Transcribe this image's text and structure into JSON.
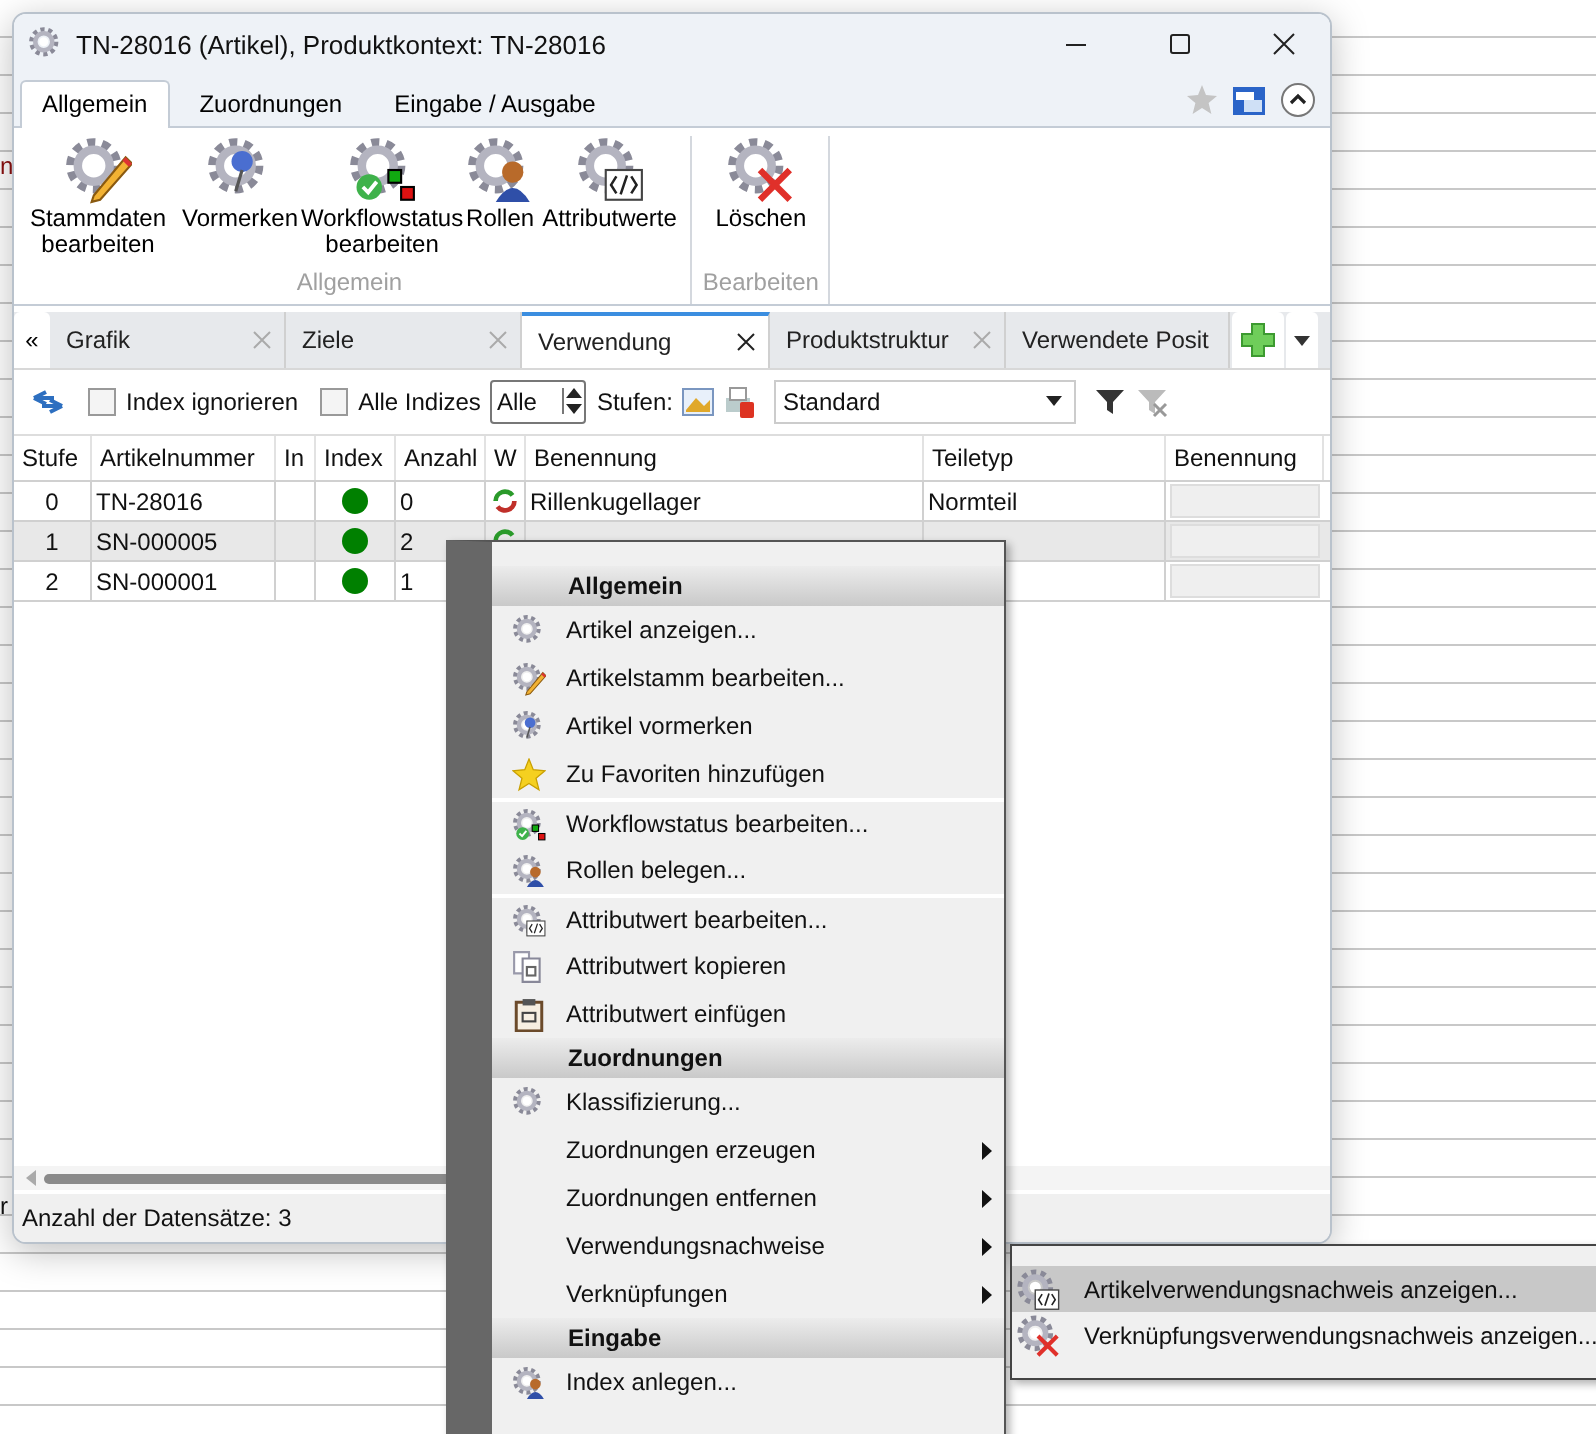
{
  "background_fragments": [
    "n",
    "r"
  ],
  "window": {
    "title": "TN-28016 (Artikel), Produktkontext: TN-28016"
  },
  "ribbon": {
    "tabs": [
      {
        "label": "Allgemein",
        "selected": true
      },
      {
        "label": "Zuordnungen",
        "selected": false
      },
      {
        "label": "Eingabe / Ausgabe",
        "selected": false
      }
    ],
    "groups": [
      {
        "label": "Allgemein",
        "buttons": [
          "Stammdaten bearbeiten",
          "Vormerken",
          "Workflowstatus bearbeiten",
          "Rollen",
          "Attributwerte"
        ]
      },
      {
        "label": "Bearbeiten",
        "buttons": [
          "Löschen"
        ]
      }
    ]
  },
  "doc_tabs": {
    "scroll_left": "«",
    "tabs": [
      {
        "label": "Grafik",
        "selected": false
      },
      {
        "label": "Ziele",
        "selected": false
      },
      {
        "label": "Verwendung",
        "selected": true
      },
      {
        "label": "Produktstruktur",
        "selected": false
      },
      {
        "label": "Verwendete Posit",
        "selected": false
      }
    ]
  },
  "toolbar": {
    "checkboxes": [
      {
        "label": "Index ignorieren",
        "checked": false
      },
      {
        "label": "Alle Indizes",
        "checked": false
      }
    ],
    "spin_value": "Alle",
    "stufen_label": "Stufen:",
    "view_dropdown": "Standard"
  },
  "table": {
    "columns": [
      "Stufe",
      "Artikelnummer",
      "In",
      "Index",
      "Anzahl",
      "W",
      "Benennung",
      "Teiletyp",
      "Benennung"
    ],
    "rows": [
      {
        "stufe": "0",
        "artikelnummer": "TN-28016",
        "color": "#008000",
        "anzahl": "0",
        "w_icon": true,
        "benennung": "Rillenkugellager",
        "teiletyp": "Normteil",
        "selected": false
      },
      {
        "stufe": "1",
        "artikelnummer": "SN-000005",
        "color": "#008000",
        "anzahl": "2",
        "w_icon": true,
        "selected": true
      },
      {
        "stufe": "2",
        "artikelnummer": "SN-000001",
        "color": "#008000",
        "anzahl": "1",
        "selected": false
      }
    ]
  },
  "status_bar": "Anzahl der Datensätze: 3",
  "context_menu": [
    {
      "kind": "header",
      "label": "Allgemein"
    },
    {
      "kind": "command",
      "label": "Artikel anzeigen...",
      "divider_above": false
    },
    {
      "kind": "command",
      "label": "Artikelstamm bearbeiten...",
      "divider_above": false
    },
    {
      "kind": "command",
      "label": "Artikel vormerken",
      "divider_above": false
    },
    {
      "kind": "command",
      "label": "Zu Favoriten hinzufügen",
      "divider_above": false
    },
    {
      "kind": "command",
      "label": "Workflowstatus bearbeiten...",
      "divider_above": true
    },
    {
      "kind": "command",
      "label": "Rollen belegen...",
      "divider_above": false
    },
    {
      "kind": "command",
      "label": "Attributwert bearbeiten...",
      "divider_above": true
    },
    {
      "kind": "command",
      "label": "Attributwert kopieren",
      "divider_above": false
    },
    {
      "kind": "command",
      "label": "Attributwert einfügen",
      "divider_above": false
    },
    {
      "kind": "header",
      "label": "Zuordnungen"
    },
    {
      "kind": "command",
      "label": "Klassifizierung...",
      "divider_above": false
    },
    {
      "kind": "submenu",
      "label": "Zuordnungen erzeugen",
      "divider_above": false
    },
    {
      "kind": "submenu",
      "label": "Zuordnungen entfernen",
      "divider_above": false
    },
    {
      "kind": "submenu",
      "label": "Verwendungsnachweise",
      "divider_above": false
    },
    {
      "kind": "submenu",
      "label": "Verknüpfungen",
      "divider_above": false
    },
    {
      "kind": "header",
      "label": "Eingabe"
    },
    {
      "kind": "command",
      "label": "Index anlegen...",
      "divider_above": false
    }
  ],
  "submenu": [
    {
      "label": "Artikelverwendungsnachweis anzeigen...",
      "selected": true
    },
    {
      "label": "Verknüpfungsverwendungsnachweis anzeigen...",
      "selected": false
    }
  ]
}
